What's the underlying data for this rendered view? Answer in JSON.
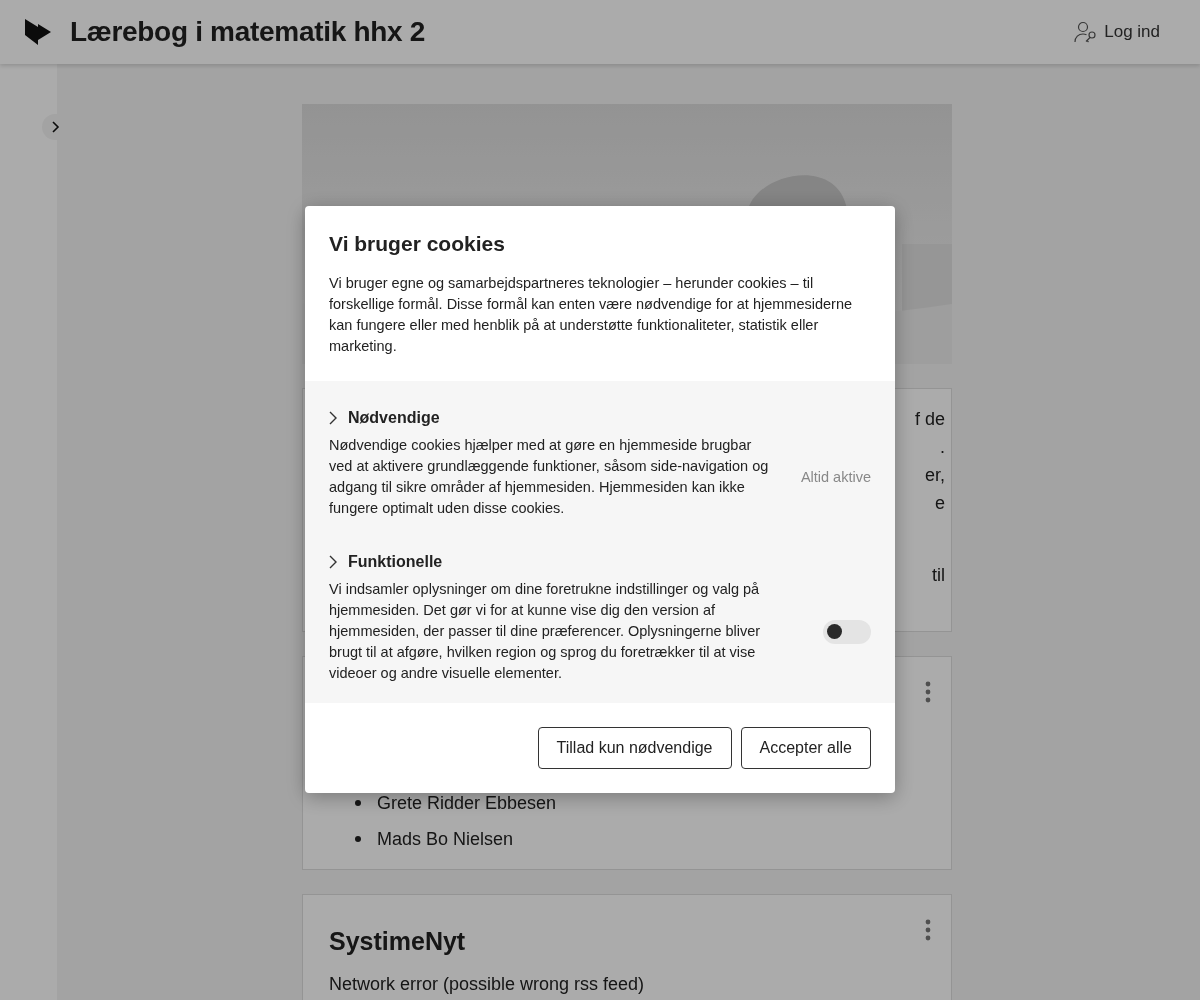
{
  "header": {
    "title": "Lærebog i matematik hhx 2",
    "login": "Log ind"
  },
  "page": {
    "intro_fragments": [
      "f de",
      ".",
      "er,",
      "e",
      "til"
    ],
    "authors": [
      "Grete Ridder Ebbesen",
      "Mads Bo Nielsen"
    ],
    "news": {
      "title": "SystimeNyt",
      "message": "Network error (possible wrong rss feed)"
    }
  },
  "cookie_dialog": {
    "title": "Vi bruger cookies",
    "text": "Vi bruger egne og samarbejdspartneres teknologier – herunder cookies – til forskellige formål. Disse formål kan enten være nødvendige for at hjemmesiderne kan fungere eller med henblik på at understøtte funktionaliteter, statistik eller marketing.",
    "categories": [
      {
        "kind": "always_active",
        "title": "Nødvendige",
        "expanded": false,
        "description": "Nødvendige cookies hjælper med at gøre en hjemmeside brugbar ved at aktivere grundlæggende funktioner, såsom side-navigation og adgang til sikre områder af hjemmesiden. Hjemmesiden kan ikke fungere optimalt uden disse cookies.",
        "status": "Altid aktive"
      },
      {
        "kind": "toggle",
        "title": "Funktionelle",
        "expanded": false,
        "description": "Vi indsamler oplysninger om dine foretrukne indstillinger og valg på hjemmesiden. Det gør vi for at kunne vise dig den version af hjemmesiden, der passer til dine præferencer. Oplysningerne bliver brugt til at afgøre, hvilken region og sprog du foretrækker til at vise videoer og andre visuelle elementer.",
        "on": false
      }
    ],
    "buttons": [
      "Tillad kun nødvendige",
      "Accepter alle"
    ]
  }
}
